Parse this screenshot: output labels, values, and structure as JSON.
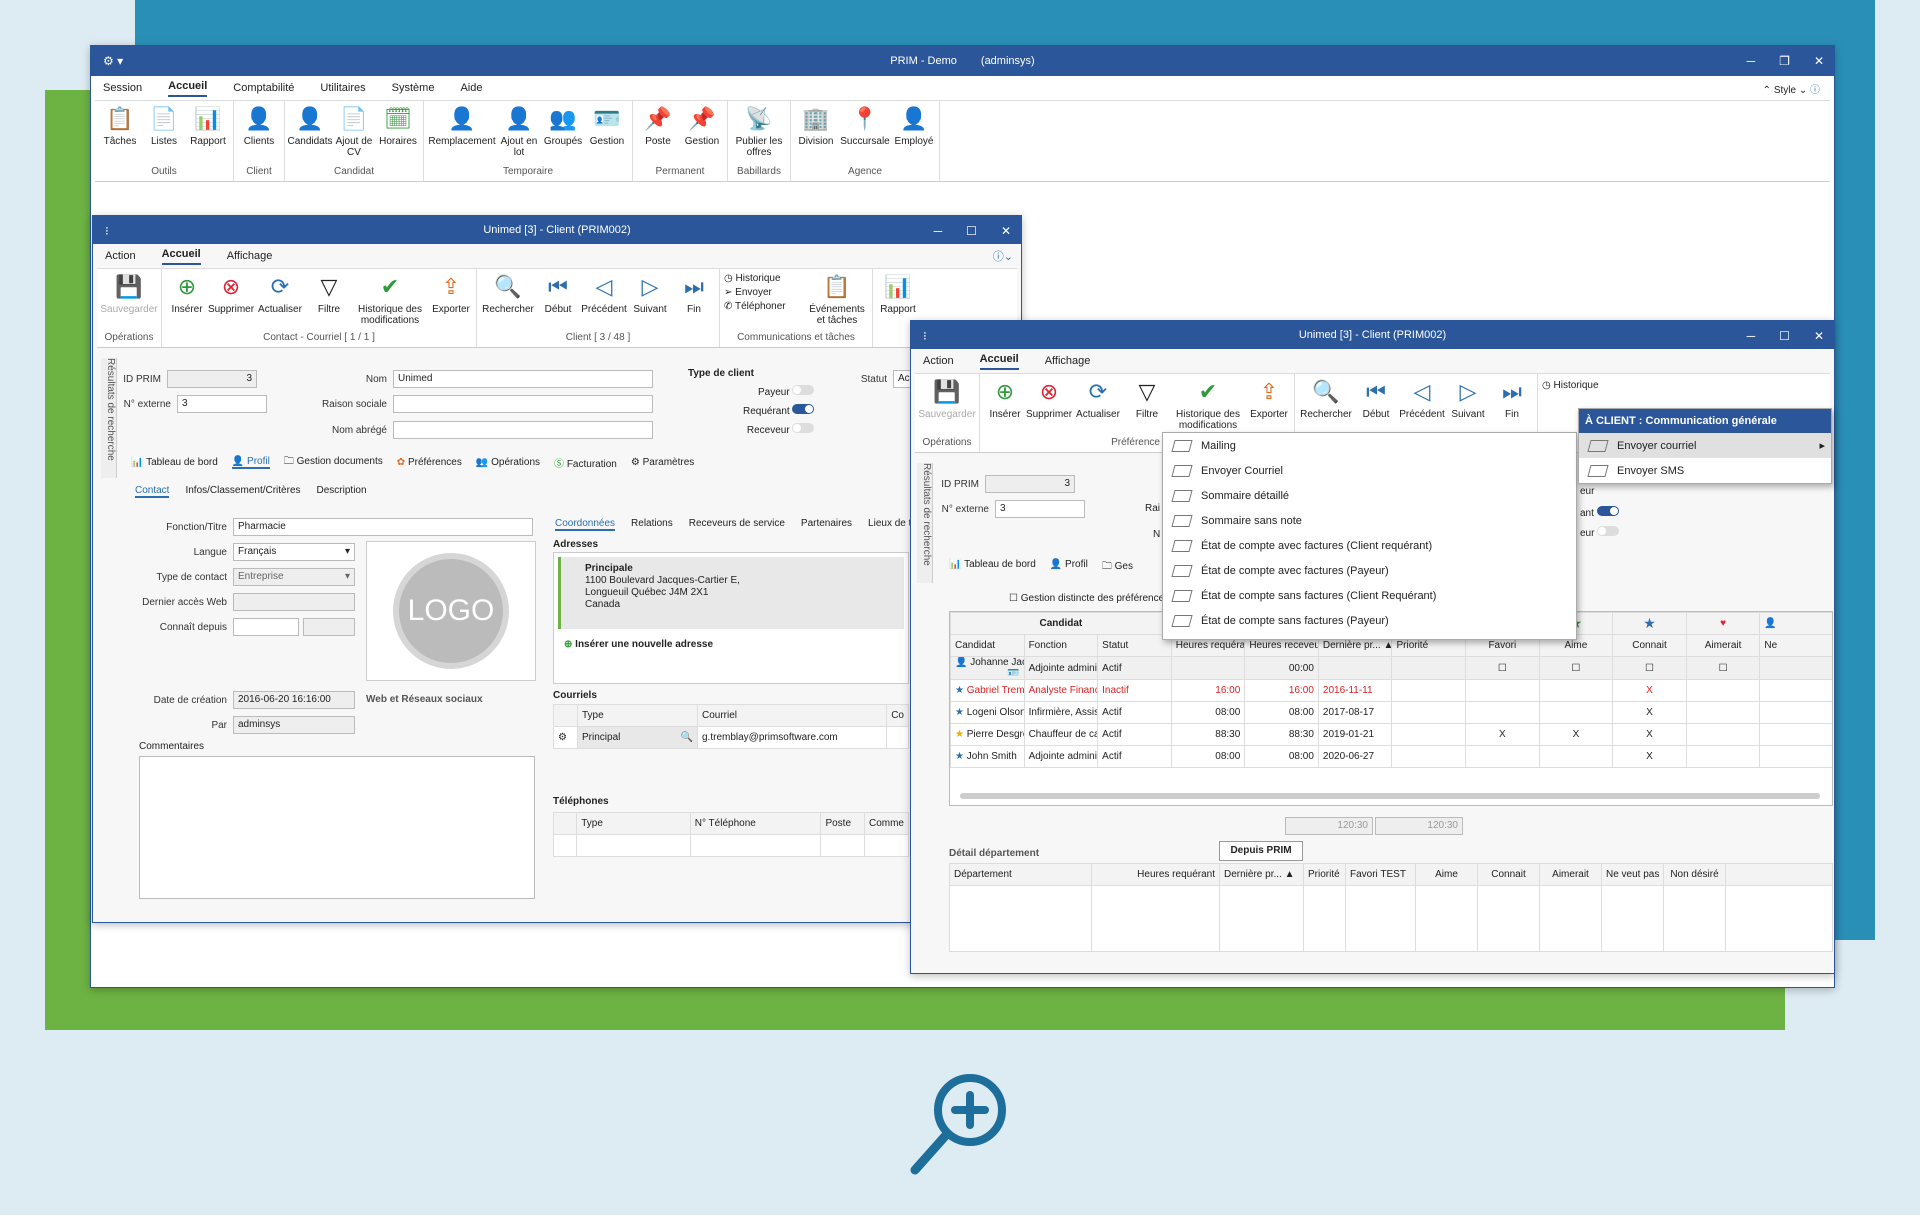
{
  "main": {
    "title": "PRIM - Demo",
    "user": "(adminsys)",
    "menu": [
      "Session",
      "Accueil",
      "Comptabilité",
      "Utilitaires",
      "Système",
      "Aide"
    ],
    "style_label": "Style",
    "groups": [
      {
        "label": "Outils",
        "buttons": [
          "Tâches",
          "Listes",
          "Rapport"
        ]
      },
      {
        "label": "Client",
        "buttons": [
          "Clients"
        ]
      },
      {
        "label": "Candidat",
        "buttons": [
          "Candidats",
          "Ajout de CV",
          "Horaires"
        ]
      },
      {
        "label": "Temporaire",
        "buttons": [
          "Remplacement",
          "Ajout en lot",
          "Groupés",
          "Gestion"
        ]
      },
      {
        "label": "Permanent",
        "buttons": [
          "Poste",
          "Gestion"
        ]
      },
      {
        "label": "Babillards",
        "buttons": [
          "Publier les offres"
        ]
      },
      {
        "label": "Agence",
        "buttons": [
          "Division",
          "Succursale",
          "Employé"
        ]
      }
    ]
  },
  "client1": {
    "title": "Unimed [3] - Client (PRIM002)",
    "menu": [
      "Action",
      "Accueil",
      "Affichage"
    ],
    "ribbon": {
      "save": "Sauvegarder",
      "insert": "Insérer",
      "delete": "Supprimer",
      "refresh": "Actualiser",
      "filter": "Filtre",
      "history": "Historique des modifications",
      "export": "Exporter",
      "search": "Rechercher",
      "first": "Début",
      "prev": "Précédent",
      "next": "Suivant",
      "last": "Fin",
      "hist_small": "Historique",
      "send": "Envoyer",
      "phone": "Téléphoner",
      "events": "Événements et tâches",
      "report": "Rapport",
      "grp_ops": "Opérations",
      "grp_contact": "Contact - Courriel [ 1 / 1 ]",
      "grp_client": "Client [ 3 / 48 ]",
      "grp_comm": "Communications et tâches"
    },
    "side_tab": "Résultats de recherche",
    "form": {
      "id_label": "ID PRIM",
      "id_value": "3",
      "ext_label": "N° externe",
      "ext_value": "3",
      "nom_label": "Nom",
      "nom_value": "Unimed",
      "raison_label": "Raison sociale",
      "abrege_label": "Nom abrégé",
      "type_client": "Type de client",
      "payeur": "Payeur",
      "requerant": "Requérant",
      "receveur": "Receveur",
      "statut": "Statut",
      "statut_value": "Ac"
    },
    "subtabs": [
      "Tableau de bord",
      "Profil",
      "Gestion documents",
      "Préférences",
      "Opérations",
      "Facturation",
      "Paramètres"
    ],
    "ptabs": [
      "Contact",
      "Infos/Classement/Critères",
      "Description"
    ],
    "contact": {
      "fonction_label": "Fonction/Titre",
      "fonction": "Pharmacie",
      "langue_label": "Langue",
      "langue": "Français",
      "typecontact_label": "Type de contact",
      "typecontact": "Entreprise",
      "acces_label": "Dernier accès Web",
      "connait_label": "Connaît depuis",
      "creation_label": "Date de création",
      "creation": "2016-06-20 16:16:00",
      "par_label": "Par",
      "par": "adminsys",
      "web_label": "Web et Réseaux sociaux",
      "comments_label": "Commentaires",
      "logo": "LOGO"
    },
    "rtabs": [
      "Coordonnées",
      "Relations",
      "Receveurs de service",
      "Partenaires",
      "Lieux de trav"
    ],
    "adresses": {
      "label": "Adresses",
      "title": "Principale",
      "l1": "1100 Boulevard Jacques-Cartier E,",
      "l2": "Longueuil Québec J4M 2X1",
      "l3": "Canada",
      "add": "Insérer une nouvelle adresse"
    },
    "courriels": {
      "label": "Courriels",
      "headers": [
        "Type",
        "Courriel",
        "Co"
      ],
      "type": "Principal",
      "email": "g.tremblay@primsoftware.com"
    },
    "telephones": {
      "label": "Téléphones",
      "headers": [
        "Type",
        "N° Téléphone",
        "Poste",
        "Comme"
      ]
    }
  },
  "client2": {
    "title": "Unimed [3] - Client (PRIM002)",
    "menu": [
      "Action",
      "Accueil",
      "Affichage"
    ],
    "ribbon": {
      "save": "Sauvegarder",
      "insert": "Insérer",
      "delete": "Supprimer",
      "refresh": "Actualiser",
      "filter": "Filtre",
      "history": "Historique des modifications",
      "export": "Exporter",
      "search": "Rechercher",
      "first": "Début",
      "prev": "Précédent",
      "next": "Suivant",
      "last": "Fin",
      "hist_small": "Historique",
      "grp_ops": "Opérations",
      "grp_pref": "Préférence"
    },
    "side_tab": "Résultats de recherche",
    "id_label": "ID PRIM",
    "id_value": "3",
    "ext_label": "N° externe",
    "ext_value": "3",
    "frag_rai": "Rai",
    "frag_n": "N",
    "frag_eur": "eur",
    "frag_ant": "ant",
    "frag_eur2": "eur",
    "subtabs": [
      "Tableau de bord",
      "Profil",
      "Ges"
    ],
    "gestion_distincte": "Gestion distincte des préférence",
    "candidat_header": "Candidat",
    "grid_headers": [
      "Candidat",
      "Fonction",
      "Statut",
      "Heures requérant",
      "Heures receveur",
      "Dernière pr...",
      "Priorité",
      "Favori",
      "Aime",
      "Connait",
      "Aimerait",
      "Ne"
    ],
    "rows": [
      {
        "name": "Johanne Jacob",
        "fonction": "Adjointe administrative...",
        "statut": "Actif",
        "hreq": "",
        "hrec": "00:00",
        "derniere": "",
        "favori": "",
        "aime": "",
        "connait": "",
        "red": false
      },
      {
        "name": "Gabriel Tremblay",
        "fonction": "Analyste Financier",
        "statut": "Inactif",
        "hreq": "16:00",
        "hrec": "16:00",
        "derniere": "2016-11-11",
        "favori": "",
        "aime": "",
        "connait": "X",
        "red": true
      },
      {
        "name": "Logeni Olson",
        "fonction": "Infirmière, Assistant(e)...",
        "statut": "Actif",
        "hreq": "08:00",
        "hrec": "08:00",
        "derniere": "2017-08-17",
        "favori": "",
        "aime": "",
        "connait": "X",
        "red": false
      },
      {
        "name": "Pierre Desgroseilliers",
        "fonction": "Chauffeur de camion, ...",
        "statut": "Actif",
        "hreq": "88:30",
        "hrec": "88:30",
        "derniere": "2019-01-21",
        "favori": "X",
        "aime": "X",
        "connait": "X",
        "red": false
      },
      {
        "name": "John Smith",
        "fonction": "Adjointe administrative...",
        "statut": "Actif",
        "hreq": "08:00",
        "hrec": "08:00",
        "derniere": "2020-06-27",
        "favori": "",
        "aime": "",
        "connait": "X",
        "red": false
      }
    ],
    "totals": [
      "120:30",
      "120:30"
    ],
    "detail_label": "Détail département",
    "depuis_prim": "Depuis PRIM",
    "detail_headers": [
      "Département",
      "Heures requérant",
      "Dernière pr...",
      "Priorité",
      "Favori TEST",
      "Aime",
      "Connait",
      "Aimerait",
      "Ne veut pas",
      "Non désiré"
    ]
  },
  "dropdown": [
    "Mailing",
    "Envoyer Courriel",
    "Sommaire détaillé",
    "Sommaire sans note",
    "État de compte avec factures (Client requérant)",
    "État de compte avec factures (Payeur)",
    "État de compte sans factures (Client Requérant)",
    "État de compte sans factures (Payeur)"
  ],
  "submenu": {
    "title": "À CLIENT : Communication générale",
    "items": [
      "Envoyer courriel",
      "Envoyer SMS"
    ]
  },
  "colors": {
    "titlebar": "#2b579a",
    "blue_bg": "#2a8fb7",
    "green_bg": "#6db343",
    "page_bg": "#ddebf3"
  }
}
